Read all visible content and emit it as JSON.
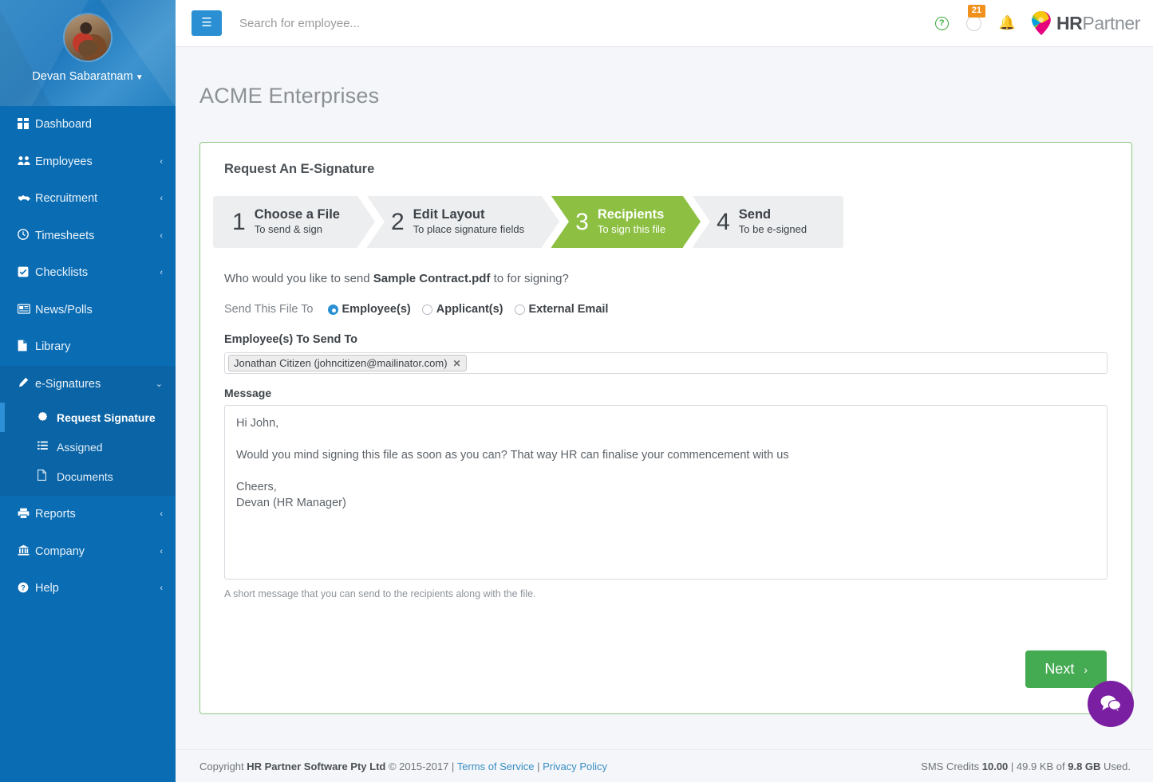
{
  "sidebar": {
    "profile_name": "Devan Sabaratnam",
    "avatar_icon": "user-photo",
    "caret_icon": "caret-down-icon",
    "items": [
      {
        "label": "Dashboard",
        "icon": "grid-icon",
        "chevron": ""
      },
      {
        "label": "Employees",
        "icon": "users-icon",
        "chevron": "‹"
      },
      {
        "label": "Recruitment",
        "icon": "handshake-icon",
        "chevron": "‹"
      },
      {
        "label": "Timesheets",
        "icon": "clock-icon",
        "chevron": "‹"
      },
      {
        "label": "Checklists",
        "icon": "check-square-icon",
        "chevron": "‹"
      },
      {
        "label": "News/Polls",
        "icon": "newspaper-icon",
        "chevron": ""
      },
      {
        "label": "Library",
        "icon": "file-icon",
        "chevron": ""
      }
    ],
    "esignatures": {
      "label": "e-Signatures",
      "icon": "pencil-icon",
      "chevron": "⌄",
      "submenu": [
        {
          "label": "Request Signature",
          "icon": "gear-icon",
          "active": true
        },
        {
          "label": "Assigned",
          "icon": "list-icon",
          "active": false
        },
        {
          "label": "Documents",
          "icon": "page-icon",
          "active": false
        }
      ]
    },
    "items_bottom": [
      {
        "label": "Reports",
        "icon": "printer-icon",
        "chevron": "‹"
      },
      {
        "label": "Company",
        "icon": "bank-icon",
        "chevron": "‹"
      },
      {
        "label": "Help",
        "icon": "question-circle-icon",
        "chevron": "‹"
      }
    ]
  },
  "header": {
    "hamburger_icon": "hamburger-icon",
    "search_placeholder": "Search for employee...",
    "search_value": "",
    "help_icon": "question-mark-icon",
    "chat_icon": "chat-icon",
    "chat_badge": "21",
    "bell_icon": "bell-icon",
    "logo_hr": "HR",
    "logo_partner": "Partner"
  },
  "main": {
    "page_title": "ACME Enterprises",
    "card_title": "Request An E-Signature",
    "wizard": [
      {
        "num": "1",
        "title": "Choose a File",
        "sub": "To send & sign",
        "active": false
      },
      {
        "num": "2",
        "title": "Edit Layout",
        "sub": "To place signature fields",
        "active": false
      },
      {
        "num": "3",
        "title": "Recipients",
        "sub": "To sign this file",
        "active": true
      },
      {
        "num": "4",
        "title": "Send",
        "sub": "To be e-signed",
        "active": false
      }
    ],
    "question_prefix": "Who would you like to send ",
    "question_file": "Sample Contract.pdf",
    "question_suffix": " to for signing?",
    "send_to_label": "Send This File To",
    "radio_options": [
      {
        "label": "Employee(s)",
        "checked": true
      },
      {
        "label": "Applicant(s)",
        "checked": false
      },
      {
        "label": "External Email",
        "checked": false
      }
    ],
    "recipients_label": "Employee(s) To Send To",
    "recipient_token": "Jonathan Citizen (johncitizen@mailinator.com)",
    "token_remove_icon": "close-icon",
    "message_label": "Message",
    "message_value": "Hi John,\n\nWould you mind signing this file as soon as you can? That way HR can finalise your commencement with us\n\nCheers,\nDevan (HR Manager)",
    "message_help": "A short message that you can send to the recipients along with the file.",
    "next_label": "Next",
    "next_arrow": "›",
    "chat_fab_icon": "chat-bubbles-icon"
  },
  "footer": {
    "copyright_prefix": "Copyright ",
    "company": "HR Partner Software Pty Ltd",
    "years": " © 2015-2017 | ",
    "terms": "Terms of Service",
    "sep": " | ",
    "privacy": "Privacy Policy",
    "sms_label": "SMS Credits ",
    "sms_value": "10.00",
    "storage_sep": " | ",
    "storage_used": "49.9 KB of ",
    "storage_total": "9.8 GB",
    "storage_suffix": " Used."
  },
  "colors": {
    "sidebar": "#0a6cb3",
    "accent_blue": "#2a90d3",
    "step_green": "#8dc042",
    "button_green": "#45ab52",
    "badge_orange": "#f0911e",
    "chat_purple": "#7a1fa2"
  }
}
